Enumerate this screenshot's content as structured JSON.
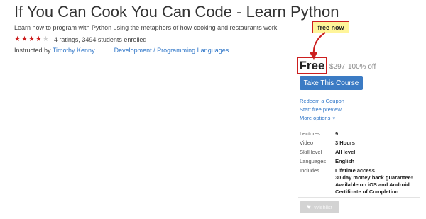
{
  "course": {
    "title": "If You Can Cook You Can Code - Learn Python",
    "subtitle": "Learn how to program with Python using the metaphors of how cooking and restaurants work.",
    "rating": {
      "stars_filled": 4,
      "stars_total": 5,
      "text": "4 ratings, 3494 students enrolled"
    },
    "instructed_by_label": "Instructed by",
    "instructor": "Timothy Kenny",
    "category": "Development",
    "category_separator": " / ",
    "subcategory": "Programming Languages"
  },
  "annotation": {
    "callout_label": "free now",
    "accent_color": "#cc1f1f",
    "callout_bg": "#fff59a"
  },
  "pricing": {
    "price": "Free",
    "original_price": "$297",
    "discount": "100% off"
  },
  "actions": {
    "take_course_label": "Take This Course",
    "take_course_color": "#3b7bc4",
    "redeem_coupon": "Redeem a Coupon",
    "start_free_preview": "Start free preview",
    "more_options": "More options",
    "more_options_icon": "caret-down-icon",
    "wishlist_label": "Wishlist",
    "wishlist_icon": "heart-icon"
  },
  "details": {
    "lectures": {
      "label": "Lectures",
      "value": "9"
    },
    "video": {
      "label": "Video",
      "value": "3 Hours"
    },
    "skill_level": {
      "label": "Skill level",
      "value": "All level"
    },
    "languages": {
      "label": "Languages",
      "value": "English"
    },
    "includes": {
      "label": "Includes",
      "values": [
        "Lifetime access",
        "30 day money back guarantee!",
        "Available on iOS and Android",
        "Certificate of Completion"
      ]
    }
  }
}
